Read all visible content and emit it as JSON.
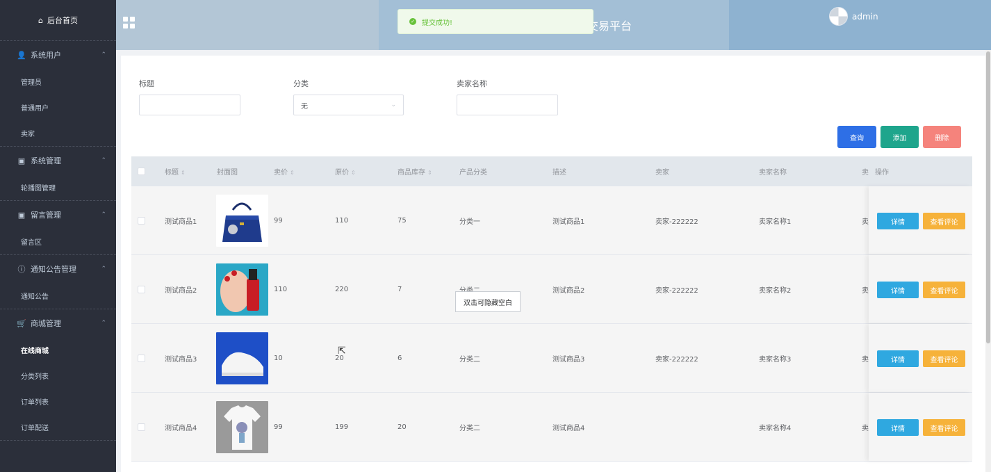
{
  "sidebar": {
    "home": "后台首页",
    "groups": [
      {
        "title": "系统用户",
        "icon": "user-icon",
        "items": [
          "管理员",
          "普通用户",
          "卖家"
        ]
      },
      {
        "title": "系统管理",
        "icon": "picture-icon",
        "items": [
          "轮播图管理"
        ]
      },
      {
        "title": "留言管理",
        "icon": "picture-icon",
        "items": [
          "留言区"
        ]
      },
      {
        "title": "通知公告管理",
        "icon": "info-icon",
        "items": [
          "通知公告"
        ]
      },
      {
        "title": "商城管理",
        "icon": "cart-icon",
        "items": [
          "在线商城",
          "分类列表",
          "订单列表",
          "订单配送"
        ]
      }
    ],
    "active_item": "在线商城"
  },
  "header": {
    "title": "交易平台",
    "user": "admin"
  },
  "toast": {
    "message": "提交成功!",
    "status_color": "#67c23a"
  },
  "search": {
    "title_label": "标题",
    "category_label": "分类",
    "category_value": "无",
    "seller_label": "卖家名称"
  },
  "buttons": {
    "query": "查询",
    "add": "添加",
    "delete": "删除"
  },
  "table": {
    "columns": [
      "标题",
      "封面图",
      "卖价",
      "原价",
      "商品库存",
      "产品分类",
      "描述",
      "卖家",
      "卖家名称",
      "卖",
      "操作"
    ],
    "rows": [
      {
        "title": "测试商品1",
        "price": "99",
        "original": "110",
        "stock": "75",
        "category": "分类一",
        "desc": "测试商品1",
        "seller": "卖家-222222",
        "seller_name": "卖家名称1",
        "clip": "卖",
        "image": "handbag"
      },
      {
        "title": "测试商品2",
        "price": "110",
        "original": "220",
        "stock": "7",
        "category": "分类二",
        "desc": "测试商品2",
        "seller": "卖家-222222",
        "seller_name": "卖家名称2",
        "clip": "卖",
        "image": "nail-polish"
      },
      {
        "title": "测试商品3",
        "price": "10",
        "original": "20",
        "stock": "6",
        "category": "分类二",
        "desc": "测试商品3",
        "seller": "卖家-222222",
        "seller_name": "卖家名称3",
        "clip": "卖",
        "image": "sneaker"
      },
      {
        "title": "测试商品4",
        "price": "99",
        "original": "199",
        "stock": "20",
        "category": "分类二",
        "desc": "测试商品4",
        "seller": "",
        "seller_name": "卖家名称4",
        "clip": "卖",
        "image": "tshirt"
      }
    ],
    "detail_label": "详情",
    "review_label": "查看评论"
  },
  "tooltip": "双击可隐藏空白",
  "colors": {
    "sidebar": "#2b2f3a",
    "query": "#2e6fe6",
    "add": "#1ea58c",
    "delete": "#f5837c",
    "detail": "#2fa8e0",
    "review": "#f6b23a"
  }
}
